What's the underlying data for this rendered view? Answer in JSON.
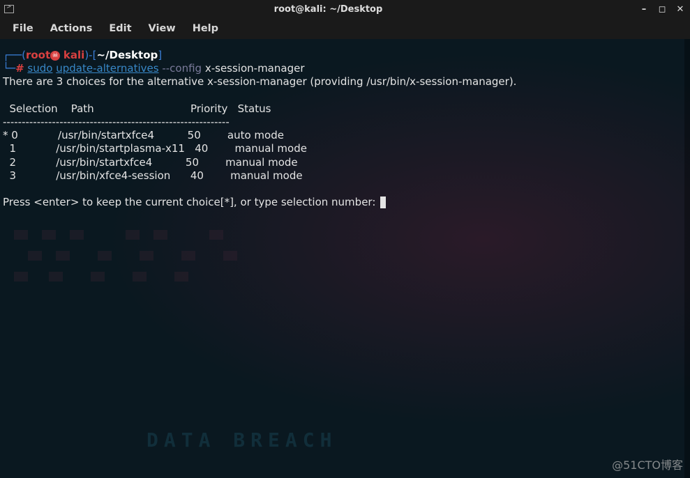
{
  "titlebar": {
    "title": "root@kali: ~/Desktop"
  },
  "menubar": {
    "items": [
      "File",
      "Actions",
      "Edit",
      "View",
      "Help"
    ]
  },
  "prompt": {
    "open_paren": "(",
    "user": "root",
    "host": "kali",
    "close_paren": ")",
    "dash": "-",
    "open_br": "[",
    "path": "~/Desktop",
    "close_br": "]",
    "hash": "#",
    "sudo": "sudo",
    "cmd": "update-alternatives",
    "flag": "--config",
    "arg": "x-session-manager"
  },
  "output": {
    "intro": "There are 3 choices for the alternative x-session-manager (providing /usr/bin/x-session-manager).",
    "header": "  Selection    Path                             Priority   Status",
    "sep": "------------------------------------------------------------",
    "rows": [
      "* 0            /usr/bin/startxfce4          50        auto mode",
      "  1            /usr/bin/startplasma-x11   40        manual mode",
      "  2            /usr/bin/startxfce4          50        manual mode",
      "  3            /usr/bin/xfce4-session      40        manual mode"
    ],
    "prompt_msg": "Press <enter> to keep the current choice[*], or type selection number: "
  },
  "bg": {
    "data_breach": "DATA BREACH"
  },
  "watermark": "@51CTO博客"
}
